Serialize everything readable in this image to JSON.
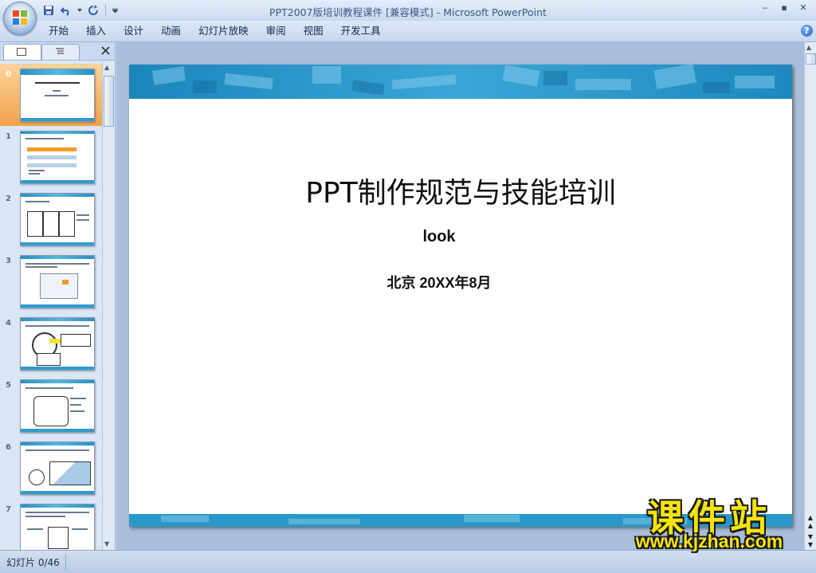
{
  "window": {
    "title": "PPT2007版培训教程课件 [兼容模式] - Microsoft PowerPoint",
    "controls": [
      "‒",
      "▪",
      "✕"
    ]
  },
  "ribbon": {
    "tabs": [
      "开始",
      "插入",
      "设计",
      "动画",
      "幻灯片放映",
      "审阅",
      "视图",
      "开发工具"
    ],
    "help": "?"
  },
  "thumbnails": {
    "numbers": [
      "0",
      "1",
      "2",
      "3",
      "4",
      "5",
      "6",
      "7"
    ],
    "selected_index": 0
  },
  "slide": {
    "title": "PPT制作规范与技能培训",
    "subtitle": "look",
    "date_line": "北京  20XX年8月"
  },
  "statusbar": {
    "slide_counter": "幻灯片 0/46"
  },
  "watermark": {
    "text": "课件站",
    "url": "www.kjzhan.com"
  },
  "colors": {
    "accent_blue": "#2f9ccd",
    "selected_thumb": "#f0a24b",
    "watermark_yellow": "#f4e40c"
  }
}
